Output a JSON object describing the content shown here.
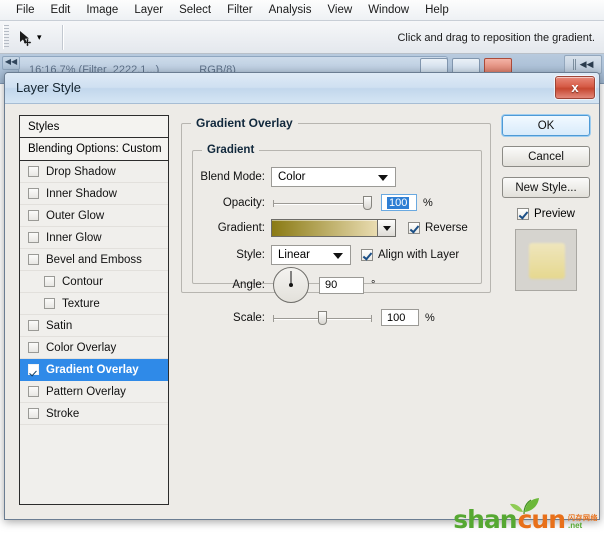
{
  "menubar": {
    "items": [
      "File",
      "Edit",
      "Image",
      "Layer",
      "Select",
      "Filter",
      "Analysis",
      "View",
      "Window",
      "Help"
    ]
  },
  "options_bar": {
    "tool_icon": "move-tool-icon",
    "tool_caret": "▾",
    "hint": "Click and drag to reposition the gradient."
  },
  "document_tab": {
    "title_left": "16:16.7% (Filter_2222.1...)",
    "title_right": "RGB/8)",
    "collapse_arrows": "◀◀",
    "left_grip": "◀◀"
  },
  "dialog": {
    "title": "Layer Style",
    "close_label": "x",
    "styles_panel": {
      "header": "Styles",
      "blending_options": "Blending Options: Custom",
      "items": [
        {
          "label": "Drop Shadow",
          "checked": false,
          "selected": false,
          "indent": false
        },
        {
          "label": "Inner Shadow",
          "checked": false,
          "selected": false,
          "indent": false
        },
        {
          "label": "Outer Glow",
          "checked": false,
          "selected": false,
          "indent": false
        },
        {
          "label": "Inner Glow",
          "checked": false,
          "selected": false,
          "indent": false
        },
        {
          "label": "Bevel and Emboss",
          "checked": false,
          "selected": false,
          "indent": false
        },
        {
          "label": "Contour",
          "checked": false,
          "selected": false,
          "indent": true
        },
        {
          "label": "Texture",
          "checked": false,
          "selected": false,
          "indent": true
        },
        {
          "label": "Satin",
          "checked": false,
          "selected": false,
          "indent": false
        },
        {
          "label": "Color Overlay",
          "checked": false,
          "selected": false,
          "indent": false
        },
        {
          "label": "Gradient Overlay",
          "checked": true,
          "selected": true,
          "indent": false
        },
        {
          "label": "Pattern Overlay",
          "checked": false,
          "selected": false,
          "indent": false
        },
        {
          "label": "Stroke",
          "checked": false,
          "selected": false,
          "indent": false
        }
      ]
    },
    "settings": {
      "group_title": "Gradient Overlay",
      "inner_group_title": "Gradient",
      "blend_mode": {
        "label": "Blend Mode:",
        "value": "Color"
      },
      "opacity": {
        "label": "Opacity:",
        "value": "100",
        "unit": "%",
        "slider_percent": 100
      },
      "gradient": {
        "label": "Gradient:",
        "start_color": "#8a7a14",
        "end_color": "#e9dcb1",
        "reverse_label": "Reverse",
        "reverse_checked": true
      },
      "style": {
        "label": "Style:",
        "value": "Linear",
        "align_label": "Align with Layer",
        "align_checked": true
      },
      "angle": {
        "label": "Angle:",
        "value": "90",
        "unit": "°",
        "degrees": 90
      },
      "scale": {
        "label": "Scale:",
        "value": "100",
        "unit": "%",
        "slider_percent": 50
      }
    },
    "buttons": {
      "ok": "OK",
      "cancel": "Cancel",
      "new_style": "New Style...",
      "preview_label": "Preview",
      "preview_checked": true
    }
  },
  "watermark": {
    "part1": "shan",
    "part2": "cun",
    "small_top": "闪存网络",
    "small_bottom": ".net"
  },
  "colors": {
    "selection_blue": "#2f8ae8",
    "title_blue": "#cfe0f1",
    "close_red": "#d65c47",
    "gradient_start": "#8a7a14",
    "gradient_end": "#e9dcb1"
  }
}
